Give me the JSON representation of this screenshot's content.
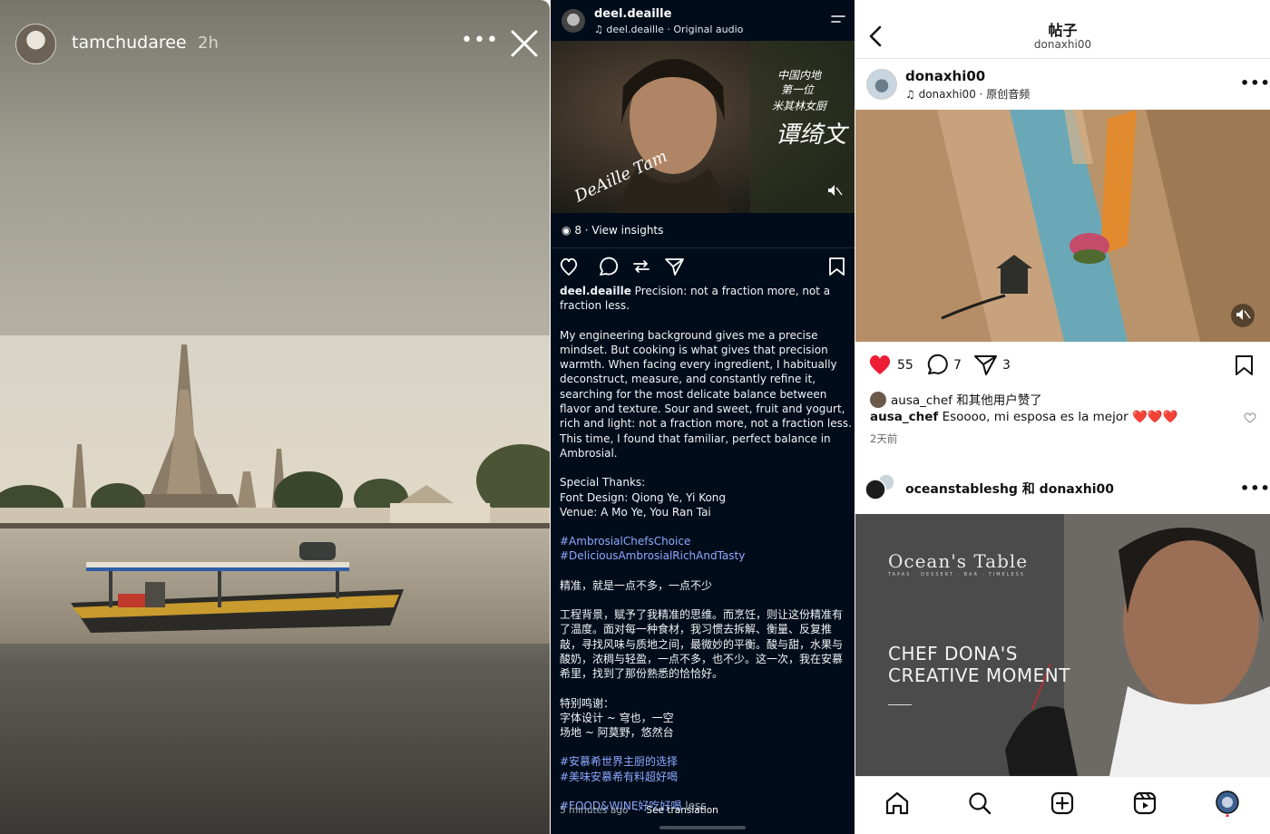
{
  "story": {
    "username": "tamchudaree",
    "time": "2h",
    "more_icon": "more-horizontal-icon",
    "close_icon": "close-icon"
  },
  "post_dark": {
    "username": "deel.deaille",
    "audio": "deel.deaille · Original audio",
    "video_overlay_en": "DeAille Tam",
    "video_overlay_cn_1": "中国内地",
    "video_overlay_cn_2": "第一位",
    "video_overlay_cn_3": "米其林女厨",
    "video_overlay_cn_4": "谭绮文",
    "insights": "8 · View insights",
    "caption_user": "deel.deaille",
    "caption_lead": "Precision: not a fraction more, not a fraction less.",
    "caption_p1": "My engineering background gives me a precise mindset. But cooking is what gives that precision warmth. When facing every ingredient, I habitually deconstruct, measure, and constantly refine it, searching for the most delicate balance between flavor and texture. Sour and sweet, fruit and yogurt, rich and light: not a fraction more, not a fraction less. This time, I found that familiar, perfect balance in Ambrosial.",
    "thanks_title": "Special Thanks:",
    "thanks_font": "Font Design: Qiong Ye, Yi Kong",
    "thanks_venue": "Venue: A Mo Ye, You Ran Tai",
    "tag1": "#AmbrosialChefsChoice",
    "tag2": "#DeliciousAmbrosialRichAndTasty",
    "cn_lead": "精准，就是一点不多，一点不少",
    "cn_p1": "工程背景，赋予了我精准的思维。而烹饪，则让这份精准有了温度。面对每一种食材，我习惯去拆解、衡量、反复推敲，寻找风味与质地之间，最微妙的平衡。酸与甜，水果与酸奶，浓稠与轻盈，一点不多，也不少。这一次，我在安慕希里，找到了那份熟悉的恰恰好。",
    "cn_thanks_title": "特别鸣谢：",
    "cn_thanks_font": "字体设计 ~ 穹也，一空",
    "cn_thanks_venue": "场地 ~ 阿莫野，悠然台",
    "cn_tag1": "#安慕希世界主厨的选择",
    "cn_tag2": "#美味安慕希有料超好喝",
    "last_tag": "#FOOD&WINE好吃好喝",
    "less": "less",
    "time": "5 minutes ago",
    "see_translation": "See translation"
  },
  "post_light": {
    "header_title": "帖子",
    "header_sub": "donaxhi00",
    "p1_user": "donaxhi00",
    "p1_audio": "donaxhi00 · 原创音频",
    "likes_count": "55",
    "comments_count": "7",
    "shares_count": "3",
    "liked_by": "ausa_chef 和其他用户赞了",
    "comment_user": "ausa_chef",
    "comment_text": "Esoooo, mi esposa es la mejor ❤️❤️❤️",
    "ago": "2天前",
    "p2_users": "oceanstableshg 和 donaxhi00",
    "p2_brand": "Ocean's Table",
    "p2_brand_sub": "TAPAS · DESSERT · BAR · TIMELESS",
    "p2_headline_1": "CHEF DONA'S",
    "p2_headline_2": "CREATIVE MOMENT",
    "colors": {
      "like_red": "#ee1d36",
      "link_blue": "#8fa9ff",
      "dark_bg": "#000c1a"
    }
  }
}
